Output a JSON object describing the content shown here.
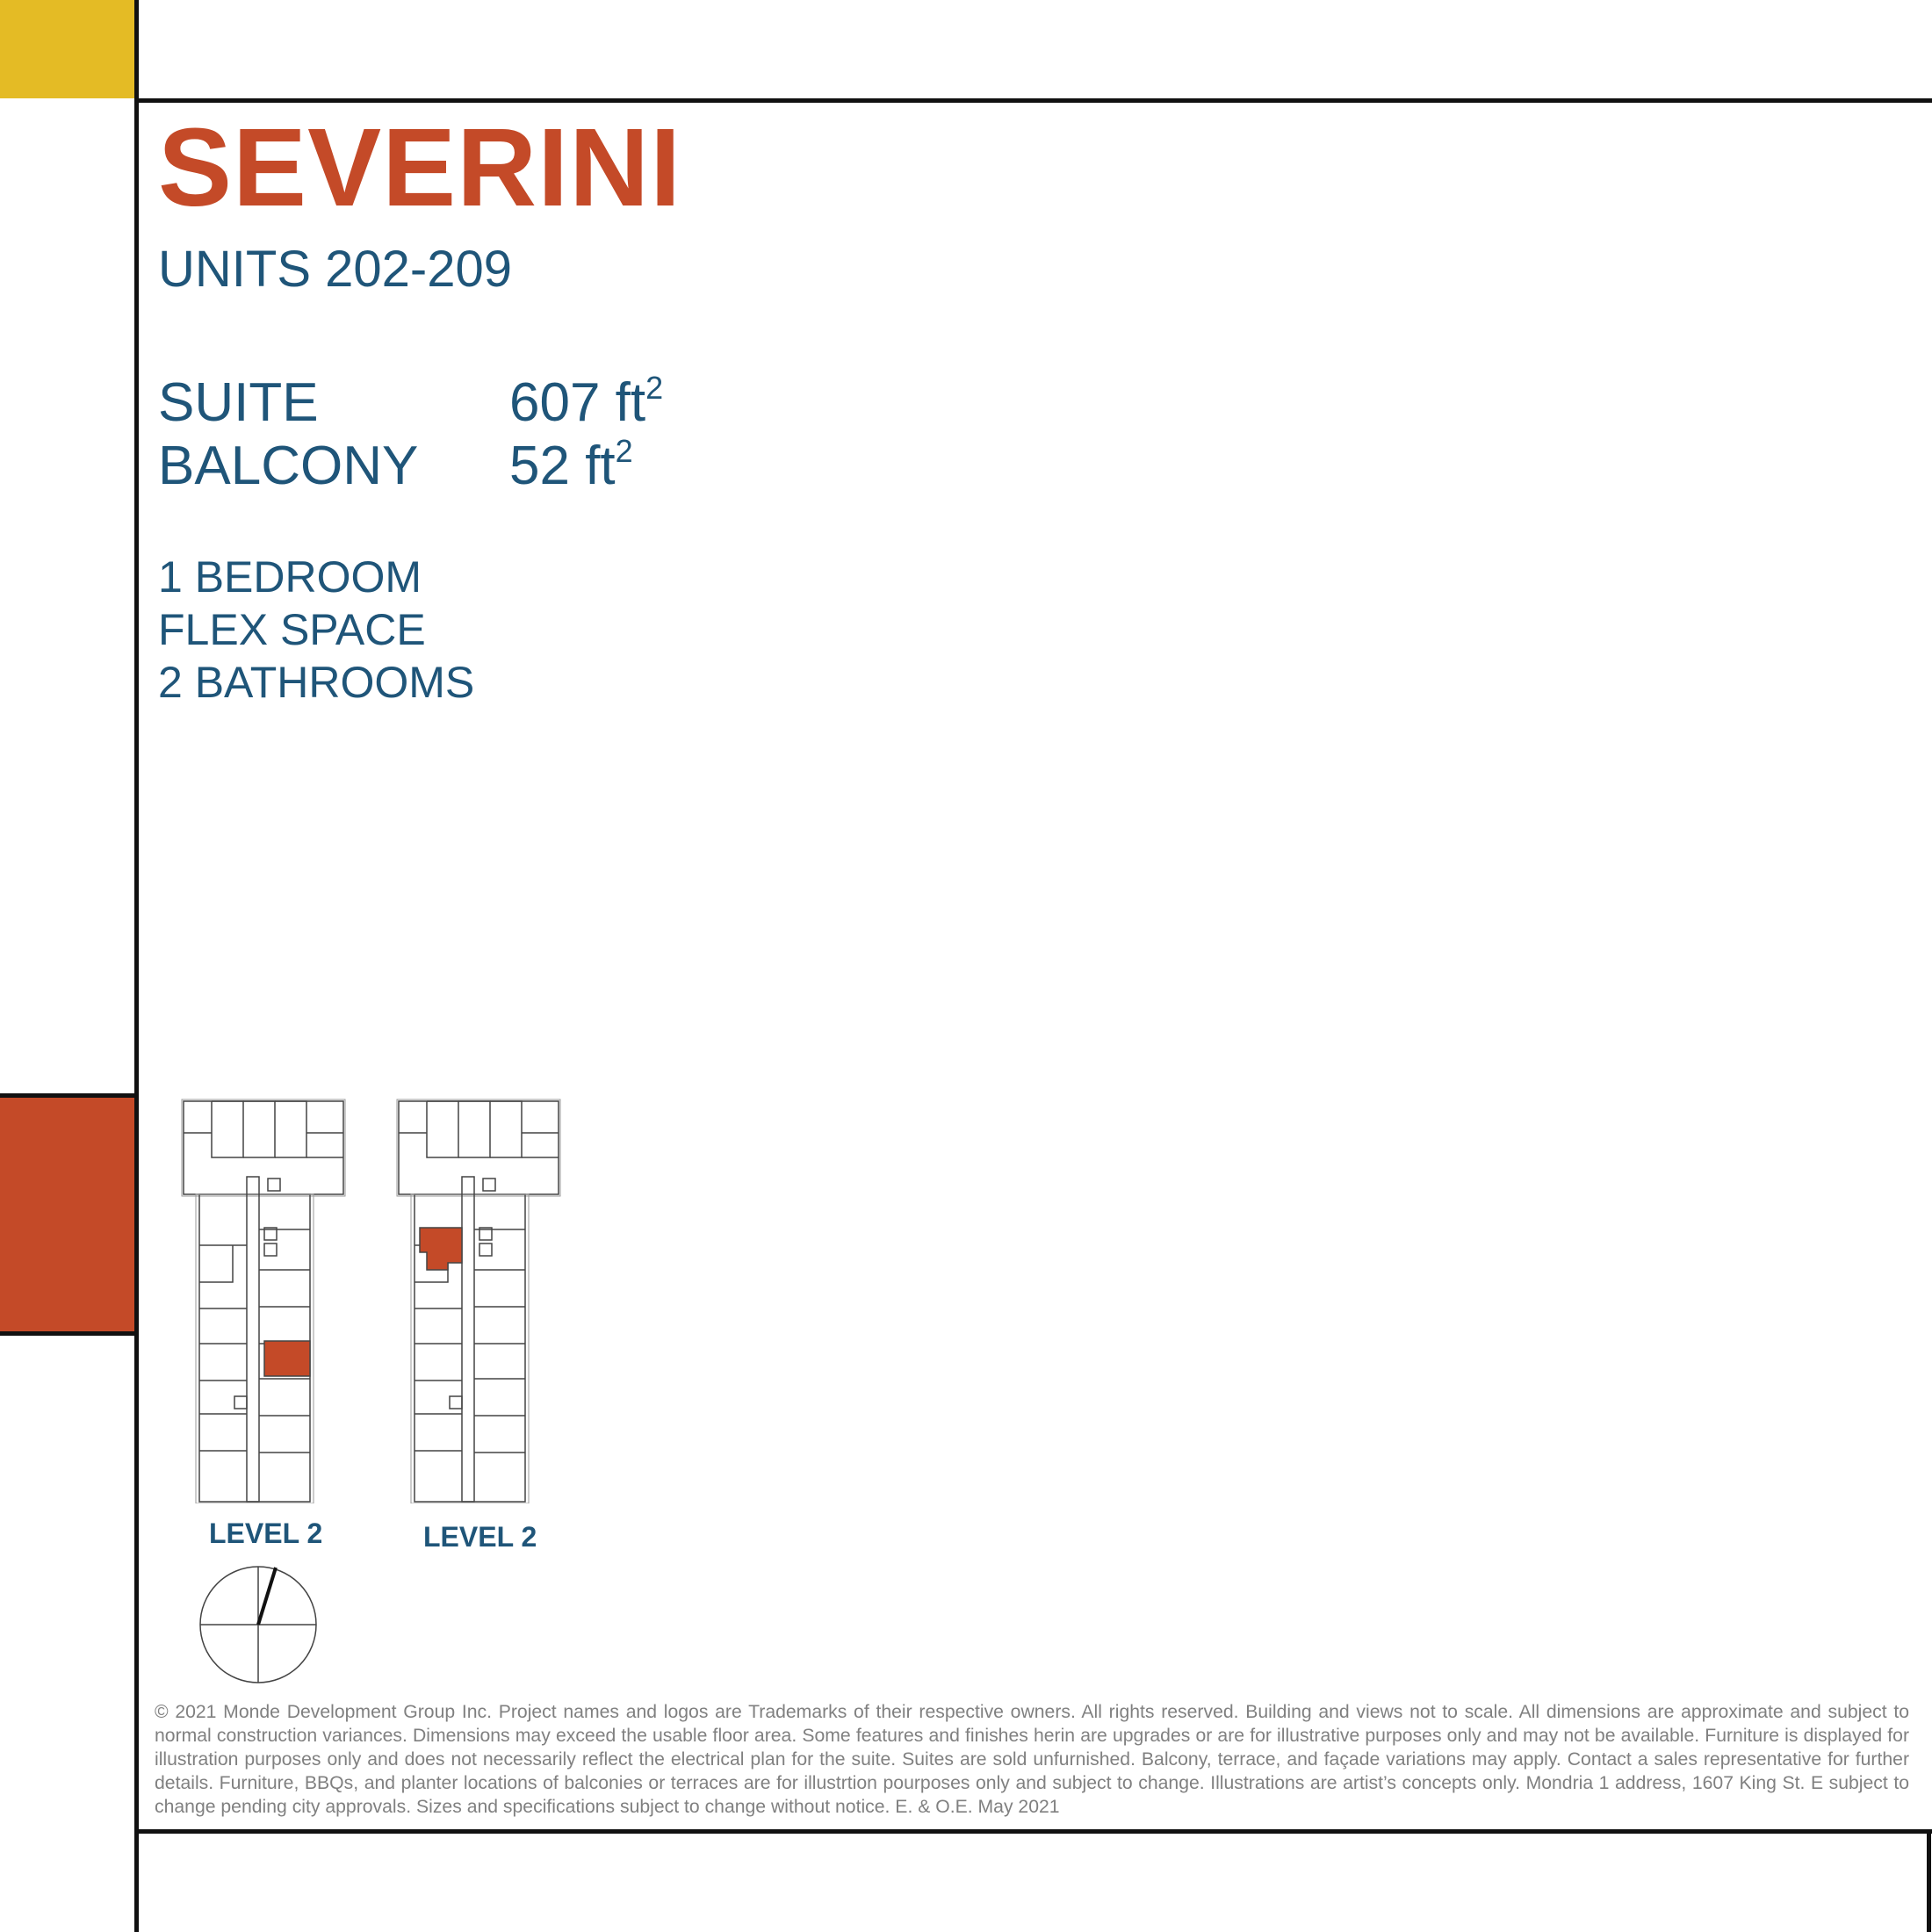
{
  "header": {
    "title": "SEVERINI",
    "subtitle": "UNITS 202-209"
  },
  "specs": [
    {
      "label": "SUITE",
      "value": "607 ft",
      "sup": "2"
    },
    {
      "label": "BALCONY",
      "value": "52 ft",
      "sup": "2"
    }
  ],
  "features": [
    "1 BEDROOM",
    "FLEX SPACE",
    "2 BATHROOMS"
  ],
  "plans": [
    {
      "label": "LEVEL 2"
    },
    {
      "label": "LEVEL 2"
    }
  ],
  "colors": {
    "accent_orange": "#c44a28",
    "accent_yellow": "#e4bb25",
    "text_blue": "#1f5579"
  },
  "footer": {
    "disclaimer": "© 2021 Monde Development Group Inc.  Project names and logos are Trademarks of their respective owners.  All rights reserved.  Building and views not to scale.  All dimensions are approximate and subject to normal construction variances.  Dimensions may exceed the usable floor area.  Some features and finishes herin are upgrades or are for illustrative purposes only and may not be available.  Furniture is displayed for illustration purposes only and does not necessarily reflect the electrical plan for the suite.  Suites are sold unfurnished.  Balcony, terrace, and façade variations may apply.  Contact a sales representative for further details.  Furniture, BBQs, and planter locations of balconies or terraces are for illustrtion pourposes only and subject to change.  Illustrations are artist’s concepts only.  Mondria 1 address, 1607 King St. E subject to change pending city approvals.  Sizes and specifications subject to change without notice. E. & O.E. May 2021"
  }
}
